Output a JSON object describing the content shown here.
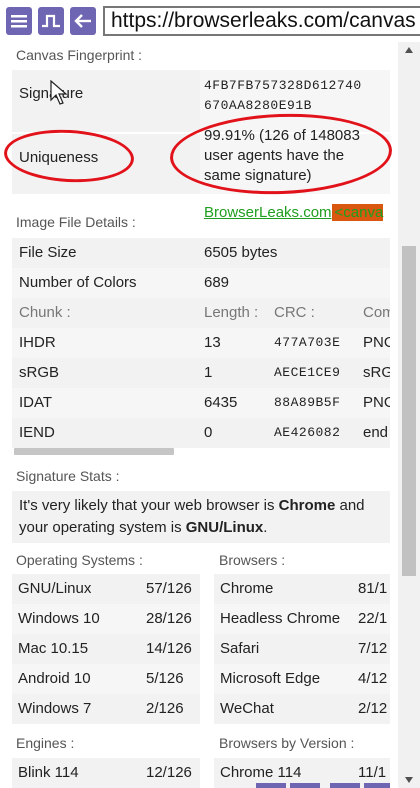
{
  "browser": {
    "url": "https://browserleaks.com/canvas"
  },
  "fingerprint": {
    "section_title": "Canvas Fingerprint :",
    "signature_label": "Signature",
    "signature_line1": "4FB7FB757328D612740",
    "signature_line2": "670AA8280E91B",
    "uniqueness_label": "Uniqueness",
    "uniqueness_line1": "99.91% (126 of 148083",
    "uniqueness_line2": "user agents have the",
    "uniqueness_line3": "same signature)"
  },
  "image_details": {
    "section_title": "Image File Details :",
    "preview_text": "BrowserLeaks.com",
    "preview_tag": "<canva",
    "file_size_label": "File Size",
    "file_size_value": "6505 bytes",
    "colors_label": "Number of Colors",
    "colors_value": "689",
    "chunk_header": {
      "chunk": "Chunk :",
      "length": "Length :",
      "crc": "CRC :",
      "comment": "Com"
    },
    "chunks": [
      {
        "chunk": "IHDR",
        "length": "13",
        "crc": "477A703E",
        "comment": "PNG"
      },
      {
        "chunk": "sRGB",
        "length": "1",
        "crc": "AECE1CE9",
        "comment": "sRG"
      },
      {
        "chunk": "IDAT",
        "length": "6435",
        "crc": "88A89B5F",
        "comment": "PNG"
      },
      {
        "chunk": "IEND",
        "length": "0",
        "crc": "AE426082",
        "comment": "end"
      }
    ]
  },
  "signature_stats": {
    "section_title": "Signature Stats :",
    "text_pre": "It's very likely that your web browser is ",
    "browser": "Chrome",
    "text_mid1": " and",
    "text_mid2": "your operating system is ",
    "os": "GNU/Linux",
    "text_post": "."
  },
  "os_stats": {
    "title": "Operating Systems :",
    "rows": [
      {
        "name": "GNU/Linux",
        "count": "57/126"
      },
      {
        "name": "Windows 10",
        "count": "28/126"
      },
      {
        "name": "Mac 10.15",
        "count": "14/126"
      },
      {
        "name": "Android 10",
        "count": "5/126"
      },
      {
        "name": "Windows 7",
        "count": "2/126"
      }
    ]
  },
  "browser_stats": {
    "title": "Browsers :",
    "rows": [
      {
        "name": "Chrome",
        "count": "81/1"
      },
      {
        "name": "Headless Chrome",
        "count": "22/1"
      },
      {
        "name": "Safari",
        "count": "7/12"
      },
      {
        "name": "Microsoft Edge",
        "count": "4/12"
      },
      {
        "name": "WeChat",
        "count": "2/12"
      }
    ]
  },
  "engines": {
    "title": "Engines :",
    "rows": [
      {
        "name": "Blink 114",
        "count": "12/126"
      }
    ]
  },
  "browsers_by_version": {
    "title": "Browsers by Version :",
    "rows": [
      {
        "name": "Chrome 114",
        "count": "11/1"
      }
    ]
  },
  "colors": {
    "accent": "#6f66b3",
    "annotation": "#e2121a",
    "preview_text": "#1f9e1f",
    "preview_tag_bg": "#d9570f"
  },
  "icons": [
    "menu-icon",
    "pulse-icon",
    "back-arrow-icon"
  ]
}
